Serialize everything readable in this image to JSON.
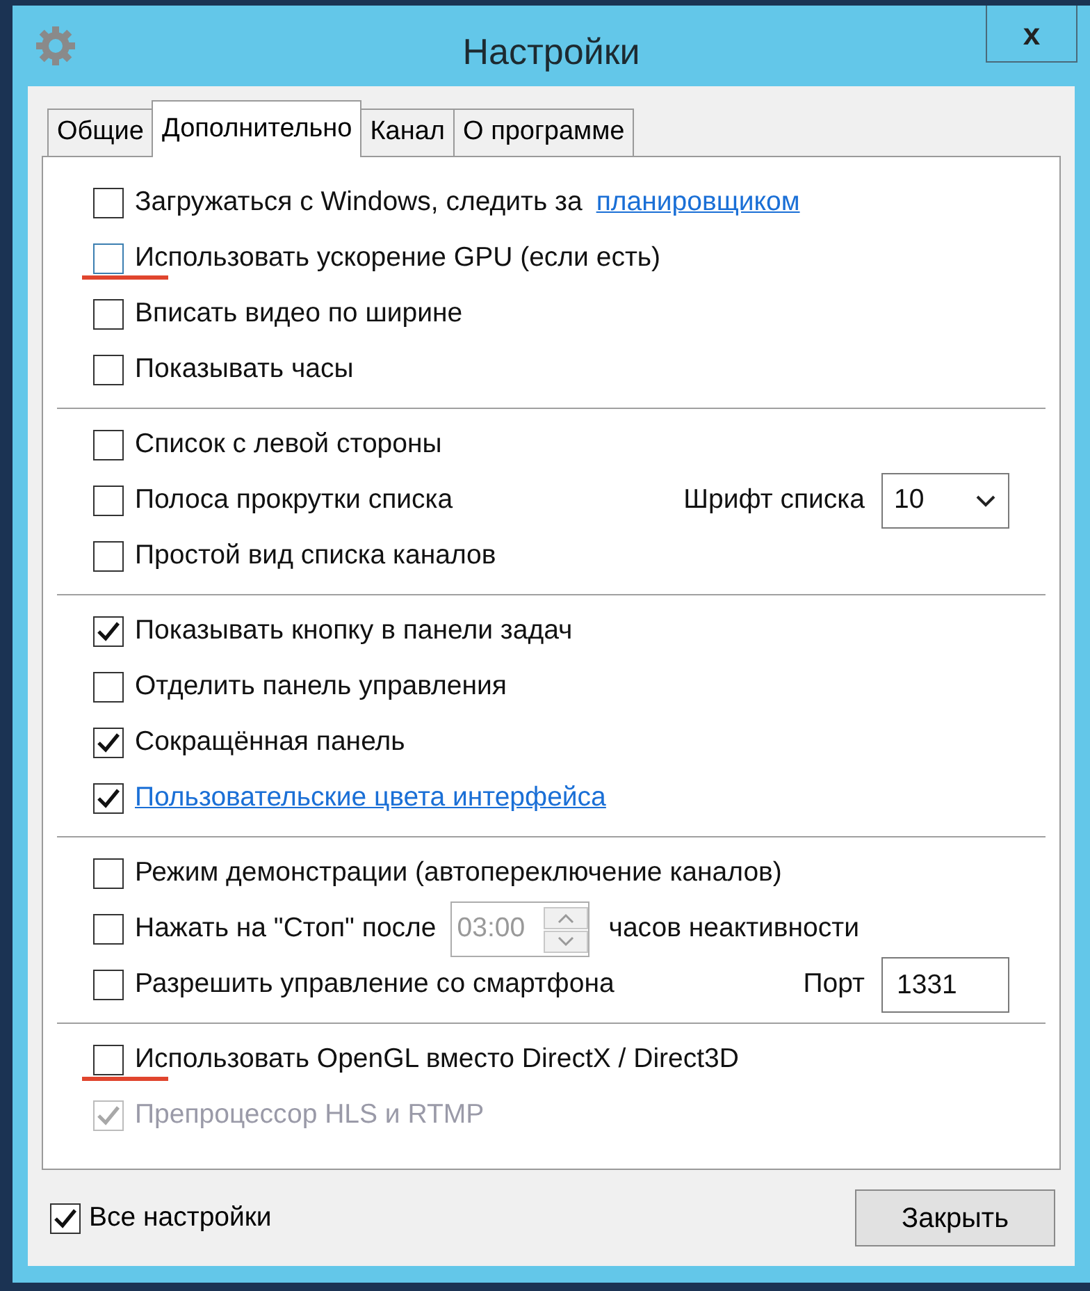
{
  "window": {
    "title": "Настройки",
    "close": "x"
  },
  "tabs": [
    {
      "label": "Общие",
      "selected": false
    },
    {
      "label": "Дополнительно",
      "selected": true
    },
    {
      "label": "Канал",
      "selected": false
    },
    {
      "label": "О программе",
      "selected": false
    }
  ],
  "sections": [
    {
      "rows": [
        {
          "kind": "check",
          "label": "Загружаться с Windows, следить за",
          "link": "планировщиком",
          "checked": false,
          "disabled": false,
          "marked": false,
          "focused": false
        },
        {
          "kind": "check",
          "label": "Использовать ускорение GPU (если есть)",
          "checked": false,
          "disabled": false,
          "marked": true,
          "focused": true
        },
        {
          "kind": "check",
          "label": "Вписать видео по ширине",
          "checked": false,
          "disabled": false,
          "marked": false,
          "focused": false
        },
        {
          "kind": "check",
          "label": "Показывать часы",
          "checked": false,
          "disabled": false,
          "marked": false,
          "focused": false
        }
      ]
    },
    {
      "rows": [
        {
          "kind": "check",
          "label": "Список с левой стороны",
          "checked": false,
          "disabled": false,
          "marked": false,
          "focused": false
        },
        {
          "kind": "check",
          "label": "Полоса прокрутки списка",
          "checked": false,
          "disabled": false,
          "marked": false,
          "focused": false,
          "extra": {
            "kind": "select",
            "label": "Шрифт списка",
            "value": "10"
          }
        },
        {
          "kind": "check",
          "label": "Простой вид списка каналов",
          "checked": false,
          "disabled": false,
          "marked": false,
          "focused": false
        }
      ]
    },
    {
      "rows": [
        {
          "kind": "check",
          "label": "Показывать кнопку в панели задач",
          "checked": true,
          "disabled": false,
          "marked": false,
          "focused": false
        },
        {
          "kind": "check",
          "label": "Отделить панель управления",
          "checked": false,
          "disabled": false,
          "marked": false,
          "focused": false
        },
        {
          "kind": "check",
          "label": "Сокращённая панель",
          "checked": true,
          "disabled": false,
          "marked": false,
          "focused": false
        },
        {
          "kind": "link_check",
          "label": "Пользовательские цвета интерфейса",
          "checked": true,
          "disabled": false,
          "marked": false,
          "focused": false
        }
      ]
    },
    {
      "rows": [
        {
          "kind": "check",
          "label": "Режим демонстрации (автопереключение каналов)",
          "checked": false,
          "disabled": false,
          "marked": false,
          "focused": false
        },
        {
          "kind": "check",
          "label": "Нажать на \"Стоп\" после",
          "checked": false,
          "disabled": false,
          "marked": false,
          "focused": false,
          "extra": {
            "kind": "spinner",
            "value": "03:00",
            "disabled": true,
            "suffix": "часов неактивности"
          }
        },
        {
          "kind": "check",
          "label": "Разрешить управление со смартфона",
          "checked": false,
          "disabled": false,
          "marked": false,
          "focused": false,
          "extra": {
            "kind": "field",
            "label": "Порт",
            "value": "1331"
          }
        }
      ]
    },
    {
      "rows": [
        {
          "kind": "check",
          "label": "Использовать OpenGL вместо DirectX / Direct3D",
          "checked": false,
          "disabled": false,
          "marked": true,
          "focused": false
        },
        {
          "kind": "check",
          "label": "Препроцессор HLS и RTMP",
          "checked": true,
          "disabled": true,
          "marked": false,
          "focused": false
        }
      ]
    }
  ],
  "footer": {
    "all_settings": {
      "label": "Все настройки",
      "checked": true
    },
    "close_button": "Закрыть"
  }
}
